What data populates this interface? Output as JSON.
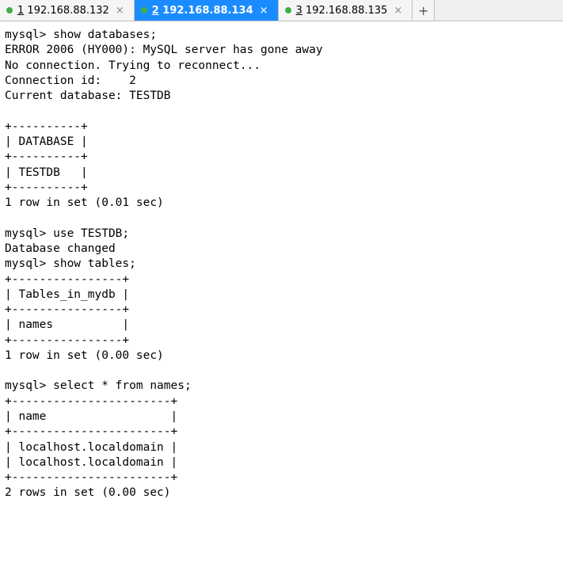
{
  "tabs": [
    {
      "num": "1",
      "label": "192.168.88.132",
      "active": false
    },
    {
      "num": "2",
      "label": "192.168.88.134",
      "active": true
    },
    {
      "num": "3",
      "label": "192.168.88.135",
      "active": false
    }
  ],
  "terminal": {
    "lines": [
      "mysql> show databases;",
      "ERROR 2006 (HY000): MySQL server has gone away",
      "No connection. Trying to reconnect...",
      "Connection id:    2",
      "Current database: TESTDB",
      "",
      "+----------+",
      "| DATABASE |",
      "+----------+",
      "| TESTDB   |",
      "+----------+",
      "1 row in set (0.01 sec)",
      "",
      "mysql> use TESTDB;",
      "Database changed",
      "mysql> show tables;",
      "+----------------+",
      "| Tables_in_mydb |",
      "+----------------+",
      "| names          |",
      "+----------------+",
      "1 row in set (0.00 sec)",
      "",
      "mysql> select * from names;",
      "+-----------------------+",
      "| name                  |",
      "+-----------------------+",
      "| localhost.localdomain |",
      "| localhost.localdomain |",
      "+-----------------------+",
      "2 rows in set (0.00 sec)"
    ]
  },
  "glyphs": {
    "close": "×",
    "plus": "+"
  }
}
